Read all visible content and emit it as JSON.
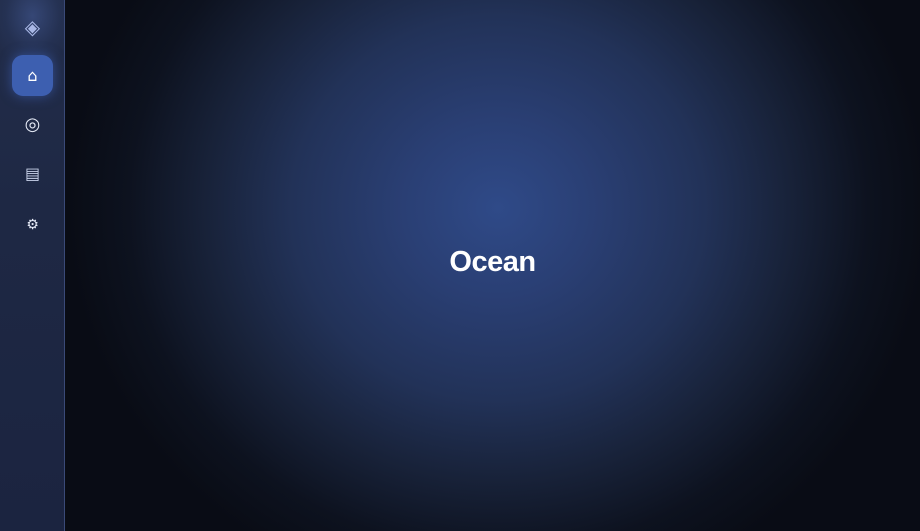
{
  "sidebar": {
    "logo_glyph": "◈",
    "logo_icon": "diamond-logo-icon",
    "items": [
      {
        "id": "home",
        "icon": "home-icon",
        "glyph": "⌂",
        "active": true
      },
      {
        "id": "target",
        "icon": "target-icon",
        "glyph": "◎",
        "active": false
      },
      {
        "id": "list",
        "icon": "list-icon",
        "glyph": "▤",
        "active": false
      },
      {
        "id": "settings",
        "icon": "gear-icon",
        "glyph": "⚙",
        "active": false
      }
    ]
  },
  "main": {
    "title": "Ocean"
  },
  "colors": {
    "sidebar_bg": "#1e2844",
    "active_item": "#3d5fb0",
    "center_glow": "#2f4a88",
    "edge_dark": "#090c15"
  }
}
